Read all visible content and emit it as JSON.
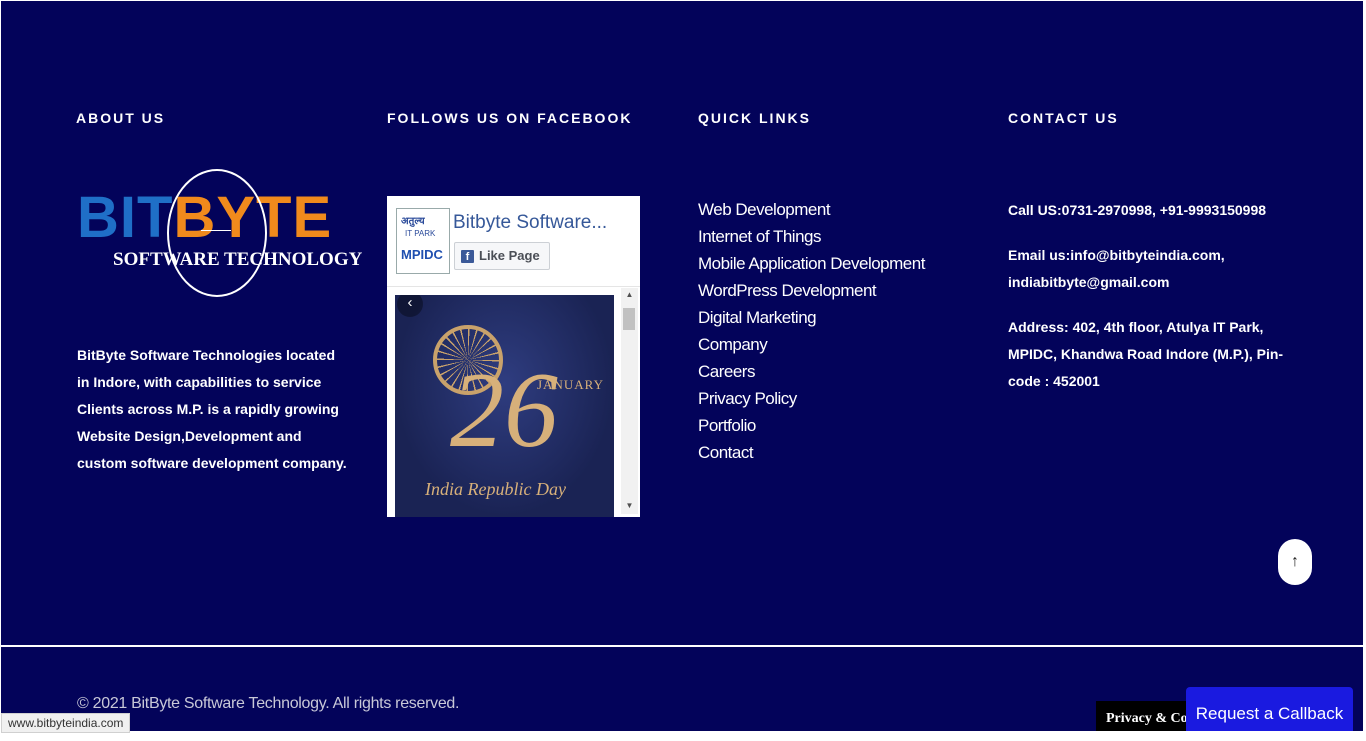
{
  "about": {
    "title": "ABOUT US",
    "logo_word_1": "BIT",
    "logo_word_2": "BYTE",
    "logo_sub": "SOFTWARE TECHNOLOGY",
    "text": "BitByte Software Technologies located in Indore, with capabilities to service Clients across M.P. is a rapidly growing Website Design,Development and custom software development company."
  },
  "facebook": {
    "title": "FOLLOWS US ON FACEBOOK",
    "page_name": "Bitbyte Software...",
    "like_label": "Like Page",
    "avatar_line1": "अतुल्य",
    "avatar_line2": "IT PARK",
    "avatar_line3": "MPIDC",
    "post_day": "26",
    "post_month": "JANUARY",
    "post_caption": "India Republic Day"
  },
  "quick_links": {
    "title": "QUICK LINKS",
    "items": [
      "Web Development",
      "Internet of Things",
      "Mobile Application Development",
      "WordPress Development",
      "Digital Marketing",
      "Company",
      "Careers",
      "Privacy Policy",
      "Portfolio",
      "Contact"
    ]
  },
  "contact": {
    "title": "CONTACT US",
    "phone": "Call US:0731-2970998, +91-9993150998",
    "email": "Email us:info@bitbyteindia.com, indiabitbyte@gmail.com",
    "address": "Address: 402, 4th floor, Atulya IT Park, MPIDC, Khandwa Road Indore (M.P.), Pin-code : 452001"
  },
  "footer": {
    "copyright": "© 2021 BitByte Software Technology. All rights reserved.",
    "status_url": "www.bitbyteindia.com",
    "privacy_label": "Privacy & Cookies",
    "callback_label": "Request a Callback",
    "to_top_icon": "arrow-up-icon"
  },
  "colors": {
    "background": "#03035a",
    "logo_blue": "#1f6fc7",
    "logo_orange": "#f08a1c",
    "callback": "#1a1ae0"
  }
}
